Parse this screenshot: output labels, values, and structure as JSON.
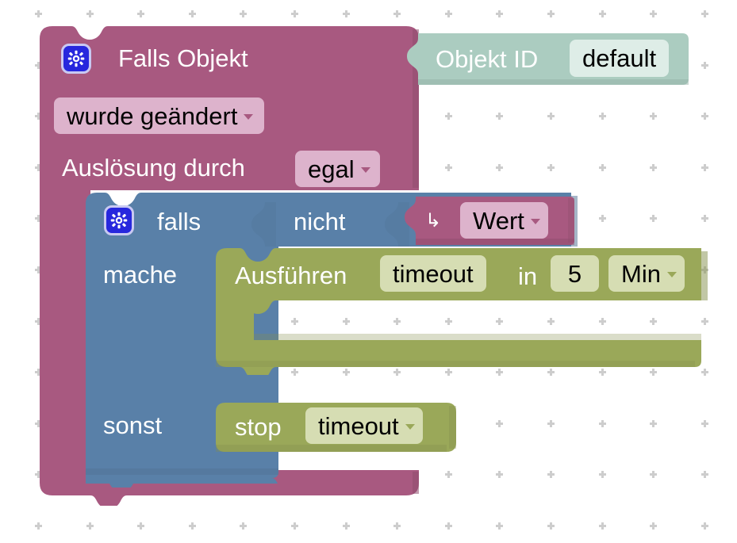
{
  "app": {
    "kind": "blockly-workspace",
    "language": "de"
  },
  "colors": {
    "trigger_block": "#A85980",
    "trigger_field": "#DDB3CC",
    "logic_block": "#5980A8",
    "logic_field": "#B3C6DD",
    "timeout_block": "#9AA859",
    "timeout_field": "#D6DDB3",
    "object_block": "#ABCCC0",
    "object_field": "#DEEDE7",
    "grid_marker": "#CDCDCD",
    "canvas": "#FFFFFF",
    "mutator_icon": "#2727DD"
  },
  "blocks": {
    "trigger": {
      "name": "on-object-change-trigger",
      "mutator_icon": "gear-icon",
      "title": "Falls Objekt",
      "condition_field": {
        "value": "wurde geändert",
        "type": "dropdown"
      },
      "trigger_by_label": "Auslösung durch",
      "trigger_by_field": {
        "value": "egal",
        "type": "dropdown"
      }
    },
    "object_id": {
      "name": "object-id-block",
      "label": "Objekt ID",
      "field": {
        "value": "default",
        "type": "text"
      }
    },
    "if_else": {
      "name": "if-else-block",
      "mutator_icon": "gear-icon",
      "if_label": "falls",
      "not_label": "nicht",
      "do_label": "mache",
      "else_label": "sonst"
    },
    "value": {
      "name": "value-getter-block",
      "arrow_icon": "return-arrow-icon",
      "field": {
        "value": "Wert",
        "type": "dropdown"
      }
    },
    "timeout_exec": {
      "name": "execute-timeout-block",
      "label": "Ausführen",
      "name_field": {
        "value": "timeout",
        "type": "text"
      },
      "in_label": "in",
      "duration_field": {
        "value": "5",
        "type": "number"
      },
      "unit_field": {
        "value": "Min",
        "type": "dropdown"
      }
    },
    "timeout_stop": {
      "name": "stop-timeout-block",
      "label": "stop",
      "field": {
        "value": "timeout",
        "type": "dropdown"
      }
    }
  }
}
